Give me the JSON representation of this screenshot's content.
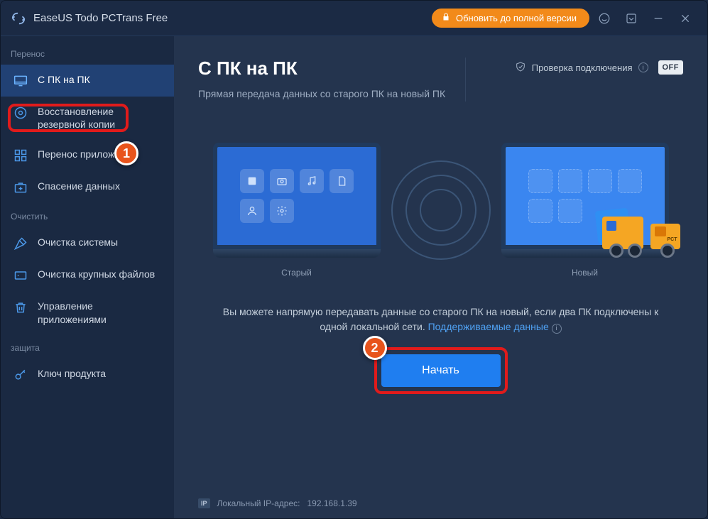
{
  "app": {
    "title": "EaseUS Todo PCTrans Free"
  },
  "titlebar": {
    "upgrade_label": "Обновить до полной версии"
  },
  "sidebar": {
    "section_transfer": "Перенос",
    "section_clean": "Очистить",
    "section_protect": "защита",
    "items": {
      "pc_to_pc": "С ПК на ПК",
      "backup_restore": "Восстановление резервной копии",
      "app_migration": "Перенос приложений",
      "data_rescue": "Спасение данных",
      "system_cleanup": "Очистка системы",
      "large_file_cleanup": "Очистка крупных файлов",
      "app_management": "Управление приложениями",
      "product_key": "Ключ продукта"
    }
  },
  "header": {
    "title": "С ПК на ПК",
    "subtitle": "Прямая передача данных со старого ПК на новый ПК",
    "check_label": "Проверка подключения",
    "off_label": "OFF"
  },
  "illustration": {
    "old_label": "Старый",
    "new_label": "Новый",
    "truck_tag": "PCT"
  },
  "description": {
    "text1": "Вы можете напрямую передавать данные со старого ПК на новый, если два ПК подключены к одной локальной сети. ",
    "link": "Поддерживаемые данные"
  },
  "actions": {
    "start_label": "Начать"
  },
  "footer": {
    "ip_badge": "IP",
    "ip_label": "Локальный IP-адрес:",
    "ip_value": "192.168.1.39"
  },
  "callouts": {
    "one": "1",
    "two": "2"
  }
}
